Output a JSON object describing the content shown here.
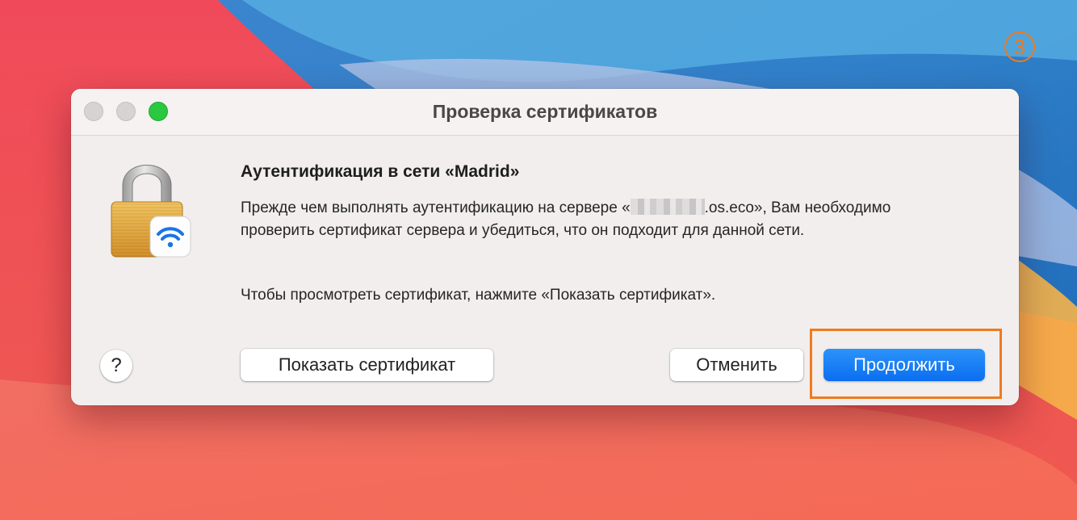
{
  "step_badge": "3",
  "dialog": {
    "title": "Проверка сертификатов",
    "heading": "Аутентификация в сети «Madrid»",
    "body_prefix": "Прежде чем выполнять аутентификацию на сервере «",
    "body_suffix": ".os.eco», Вам необходимо проверить сертификат сервера и убедиться, что он подходит для данной сети.",
    "instruction": "Чтобы просмотреть сертификат, нажмите «Показать сертификат».",
    "help_label": "?",
    "show_cert_label": "Показать сертификат",
    "cancel_label": "Отменить",
    "continue_label": "Продолжить"
  },
  "icons": {
    "main_icon": "lock-icon",
    "badge_icon": "wifi-icon"
  },
  "colors": {
    "accent": "#0a6ef0",
    "highlight": "#f07a1e",
    "zoom_button": "#2ac840"
  }
}
